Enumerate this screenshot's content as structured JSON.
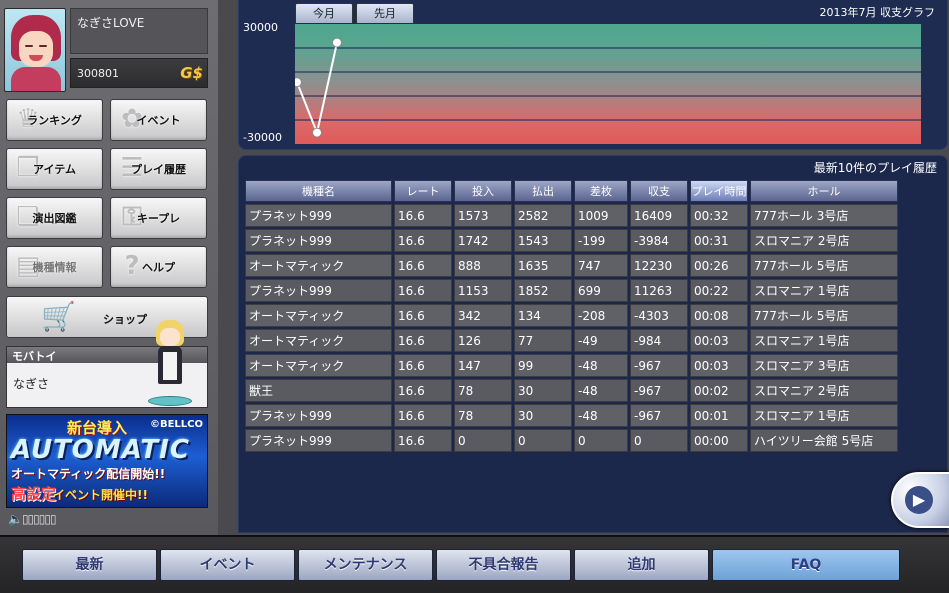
{
  "profile": {
    "username": "なぎさLOVE",
    "points": "300801",
    "currency_badge": "G$"
  },
  "nav": {
    "ranking": "ランキング",
    "event": "イベント",
    "item": "アイテム",
    "play_history": "プレイ履歴",
    "effects_gallery": "演出図鑑",
    "keep_play": "キープレ",
    "machine_info": "機種情報",
    "help": "ヘルプ",
    "shop": "ショップ"
  },
  "mobatoi": {
    "header": "モバトイ",
    "name": "なぎさ"
  },
  "banner": {
    "headline": "新台導入",
    "copyright": "©BELLCO",
    "logo": "AUTOMATIC",
    "line1": "オートマティック配信開始!!",
    "line2_red": "高設定",
    "line2_yellow": "イベント開催中!!"
  },
  "volume": {
    "icon": "speaker-icon",
    "bars": "▯▯▯▯▯▯"
  },
  "graph": {
    "title": "2013年7月 収支グラフ",
    "tabs": [
      "今月",
      "先月"
    ],
    "y_max_label": "30000",
    "y_min_label": "-30000",
    "colors": {
      "positive": "#4ea78d",
      "negative": "#e05a5a",
      "line": "#ffffff"
    }
  },
  "chart_data": {
    "type": "line",
    "title": "2013年7月 収支グラフ",
    "xlabel": "",
    "ylabel": "",
    "ylim": [
      -30000,
      30000
    ],
    "x": [
      1,
      2,
      3
    ],
    "series": [
      {
        "values": [
          1000,
          -27000,
          23000
        ]
      }
    ],
    "grid": true
  },
  "history": {
    "title": "最新10件のプレイ履歴",
    "columns": [
      "機種名",
      "レート",
      "投入",
      "払出",
      "差枚",
      "収支",
      "プレイ時間",
      "ホール"
    ],
    "active_column": 6,
    "rows": [
      [
        "プラネット999",
        "16.6",
        "1573",
        "2582",
        "1009",
        "16409",
        "00:32",
        "777ホール 3号店"
      ],
      [
        "プラネット999",
        "16.6",
        "1742",
        "1543",
        "-199",
        "-3984",
        "00:31",
        "スロマニア 2号店"
      ],
      [
        "オートマティック",
        "16.6",
        "888",
        "1635",
        "747",
        "12230",
        "00:26",
        "777ホール 5号店"
      ],
      [
        "プラネット999",
        "16.6",
        "1153",
        "1852",
        "699",
        "11263",
        "00:22",
        "スロマニア 1号店"
      ],
      [
        "オートマティック",
        "16.6",
        "342",
        "134",
        "-208",
        "-4303",
        "00:08",
        "777ホール 5号店"
      ],
      [
        "オートマティック",
        "16.6",
        "126",
        "77",
        "-49",
        "-984",
        "00:03",
        "スロマニア 1号店"
      ],
      [
        "オートマティック",
        "16.6",
        "147",
        "99",
        "-48",
        "-967",
        "00:03",
        "スロマニア 3号店"
      ],
      [
        "獣王",
        "16.6",
        "78",
        "30",
        "-48",
        "-967",
        "00:02",
        "スロマニア 2号店"
      ],
      [
        "プラネット999",
        "16.6",
        "78",
        "30",
        "-48",
        "-967",
        "00:01",
        "スロマニア 1号店"
      ],
      [
        "プラネット999",
        "16.6",
        "0",
        "0",
        "0",
        "0",
        "00:00",
        "ハイツリー会館 5号店"
      ]
    ]
  },
  "next_arrow": "▶",
  "bottom_bar": [
    "最新",
    "イベント",
    "メンテナンス",
    "不具合報告",
    "追加",
    "FAQ"
  ],
  "bottom_active": 5
}
